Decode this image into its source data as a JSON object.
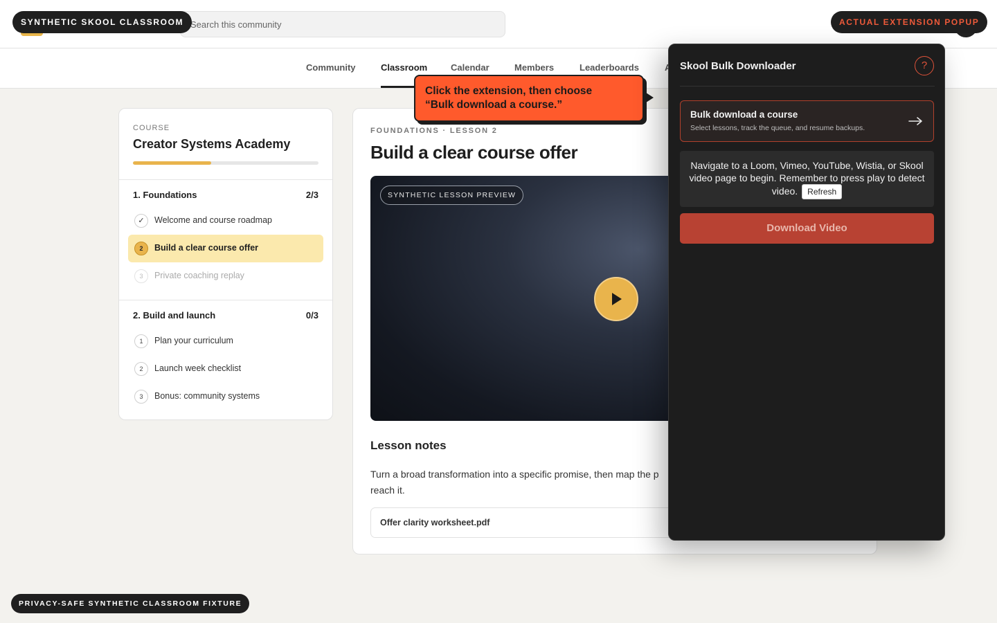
{
  "header": {
    "brand_pill": "SYNTHETIC SKOOL CLASSROOM",
    "search_placeholder": "Search this community",
    "extension_pill": "ACTUAL EXTENSION POPUP"
  },
  "nav": {
    "tabs": [
      {
        "label": "Community"
      },
      {
        "label": "Classroom",
        "active": true
      },
      {
        "label": "Calendar"
      },
      {
        "label": "Members"
      },
      {
        "label": "Leaderboards"
      },
      {
        "label": "A"
      }
    ]
  },
  "sidebar": {
    "kicker": "COURSE",
    "course_title": "Creator Systems Academy",
    "progress_percent": 42,
    "sections": [
      {
        "title": "1. Foundations",
        "count": "2/3",
        "lessons": [
          {
            "marker": "✓",
            "label": "Welcome and course roadmap",
            "state": "done"
          },
          {
            "marker": "2",
            "label": "Build a clear course offer",
            "state": "current"
          },
          {
            "marker": "3",
            "label": "Private coaching replay",
            "state": "locked"
          }
        ]
      },
      {
        "title": "2. Build and launch",
        "count": "0/3",
        "lessons": [
          {
            "marker": "1",
            "label": "Plan your curriculum",
            "state": "todo"
          },
          {
            "marker": "2",
            "label": "Launch week checklist",
            "state": "todo"
          },
          {
            "marker": "3",
            "label": "Bonus: community systems",
            "state": "todo"
          }
        ]
      }
    ]
  },
  "main": {
    "kicker": "FOUNDATIONS · LESSON 2",
    "title": "Build a clear course offer",
    "video_badge": "SYNTHETIC LESSON PREVIEW",
    "notes_title": "Lesson notes",
    "notes_body": "Turn a broad transformation into a specific promise, then map the p",
    "notes_body_line2": "reach it.",
    "attachment": "Offer clarity worksheet.pdf"
  },
  "callout": {
    "line1": "Click the extension, then choose",
    "line2": "“Bulk download a course.”"
  },
  "popup": {
    "title": "Skool Bulk Downloader",
    "help": "?",
    "bulk_title": "Bulk download a course",
    "bulk_subtitle": "Select lessons, track the queue, and resume backups.",
    "info_text": "Navigate to a Loom, Vimeo, YouTube, Wistia, or Skool video page to begin. Remember to press play to detect video.",
    "refresh_label": "Refresh",
    "download_label": "Download Video",
    "accent_color": "#e0533a"
  },
  "footer": {
    "pill": "PRIVACY-SAFE SYNTHETIC CLASSROOM FIXTURE"
  }
}
